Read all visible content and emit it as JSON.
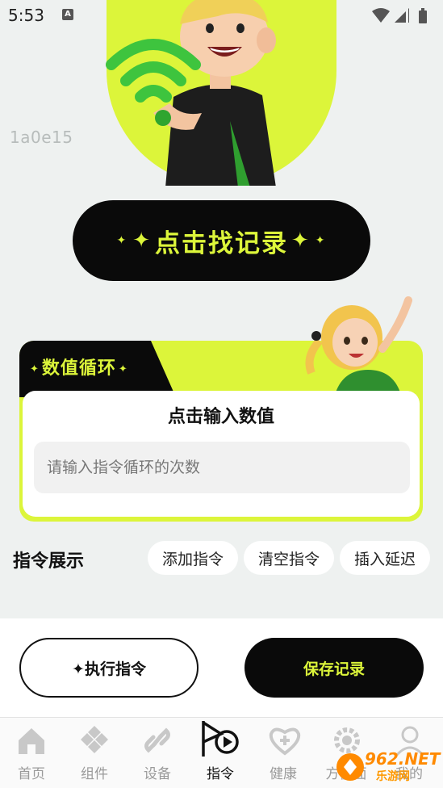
{
  "status_bar": {
    "time": "5:53",
    "notification_badge": "A"
  },
  "hero": {
    "id_text": "1a0e15"
  },
  "cta": {
    "label": "点击找记录",
    "spark": "✦"
  },
  "loop": {
    "tab_label": "数值循环",
    "heading": "点击输入数值",
    "input_placeholder": "请输入指令循环的次数",
    "input_value": ""
  },
  "commands": {
    "title": "指令展示",
    "chips": [
      "添加指令",
      "清空指令",
      "插入延迟"
    ]
  },
  "actions": {
    "execute_label": "✦执行指令",
    "save_label": "保存记录"
  },
  "tabs": [
    {
      "label": "首页",
      "icon": "home-icon",
      "active": false
    },
    {
      "label": "组件",
      "icon": "components-icon",
      "active": false
    },
    {
      "label": "设备",
      "icon": "link-icon",
      "active": false
    },
    {
      "label": "指令",
      "icon": "flag-play-icon",
      "active": true
    },
    {
      "label": "健康",
      "icon": "heart-plus-icon",
      "active": false
    },
    {
      "label": "方便面",
      "icon": "gear-icon",
      "active": false
    },
    {
      "label": "我的",
      "icon": "user-icon",
      "active": false
    }
  ],
  "watermark": {
    "brand": "962.NET",
    "sub": "乐游网"
  },
  "colors": {
    "accent": "#dcf53a",
    "dark": "#0a0a0a",
    "background": "#eef1f0"
  }
}
